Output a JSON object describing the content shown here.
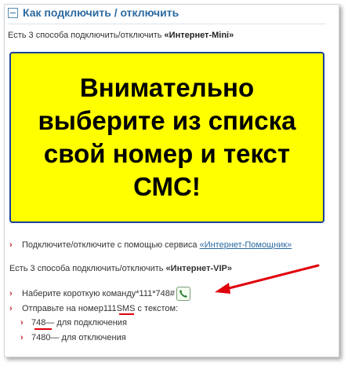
{
  "section": {
    "title": "Как подключить / отключить",
    "intro_prefix": "Есть 3 способа подключить/отключить ",
    "intro_service": "«Интернет-Mini»"
  },
  "banner": {
    "text": "Внимательно выберите из списка свой номер и текст СМС!"
  },
  "items": {
    "assistant_prefix": "Подключите/отключите с помощью сервиса ",
    "assistant_link": "«Интернет-Помощник»",
    "vip_prefix": "Есть 3 способа подключить/отключить ",
    "vip_service": "«Интернет-VIP»",
    "ussd_prefix": "Наберите короткую команду ",
    "ussd_code": "*111*748#",
    "sms_prefix": "Отправьте на номер ",
    "sms_number": "111",
    "sms_suffix": " SMS с текстом:",
    "sms_on_code": "748",
    "sms_on_text": " — для подключения",
    "sms_off_code": "7480",
    "sms_off_text": " — для отключения"
  },
  "icons": {
    "bullet": "›",
    "phone": "call-icon"
  },
  "colors": {
    "link": "#2c6aa0",
    "banner_bg": "#ffff00",
    "banner_border": "#1a3f99",
    "annotation_red": "#e0000b",
    "bullet_red": "#c0282d"
  }
}
